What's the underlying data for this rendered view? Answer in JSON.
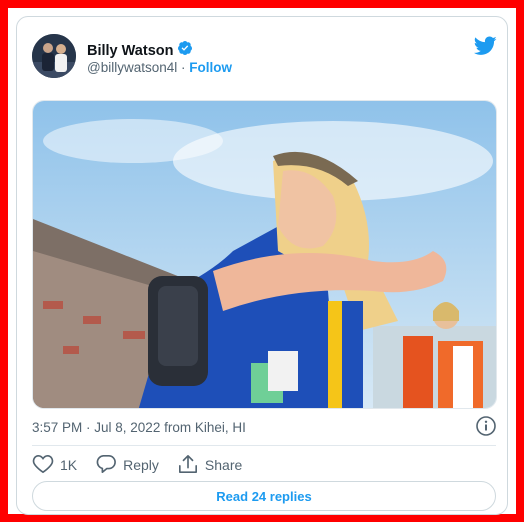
{
  "author": {
    "name": "Billy Watson",
    "handle": "@billywatson4l",
    "separator": "·",
    "follow_label": "Follow",
    "verified_icon": "verified-badge-icon"
  },
  "brand": {
    "icon": "twitter-bird-icon",
    "color": "#1d9bf0"
  },
  "tweet": {
    "timestamp": "3:57 PM · Jul 8, 2022 from Kihei, HI"
  },
  "actions": {
    "like_count": "1K",
    "reply_label": "Reply",
    "share_label": "Share"
  },
  "replies_button": "Read 24 replies",
  "colors": {
    "accent": "#1d9bf0",
    "frame": "#ff0000",
    "text_primary": "#0f1419",
    "text_secondary": "#536471"
  }
}
